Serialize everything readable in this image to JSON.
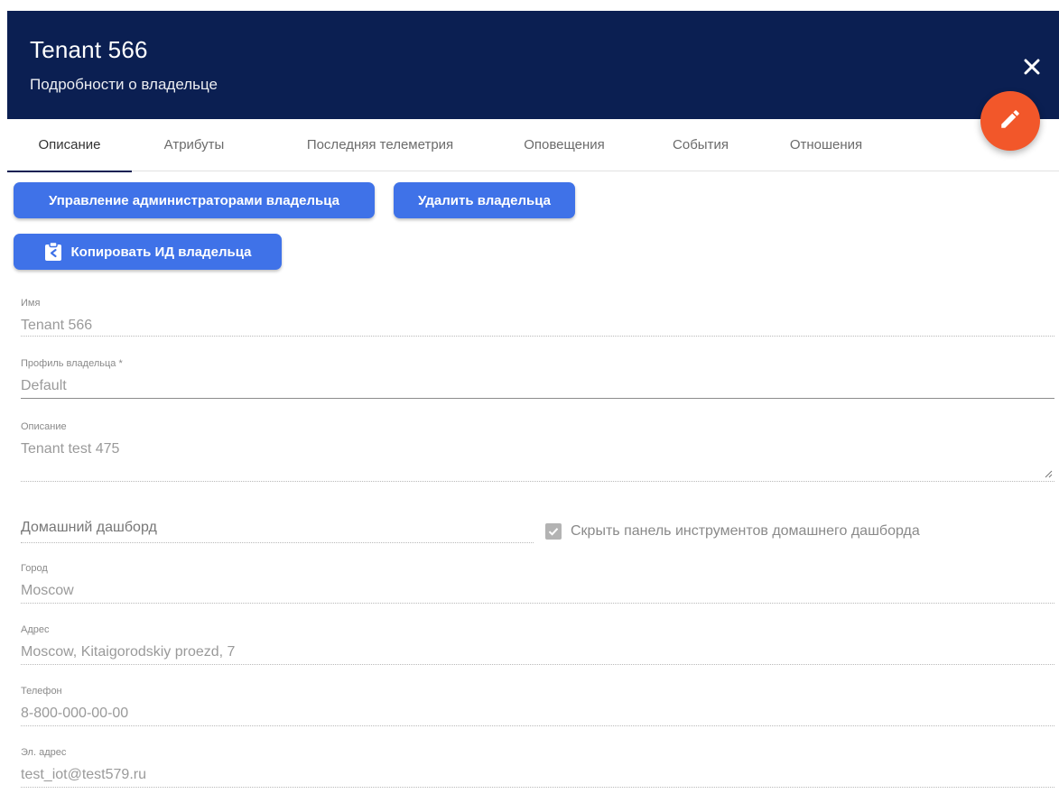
{
  "header": {
    "title": "Tenant 566",
    "subtitle": "Подробности о владельце",
    "close_icon": "close-icon",
    "edit_icon": "pencil-icon"
  },
  "tabs": [
    {
      "label": "Описание",
      "active": true
    },
    {
      "label": "Атрибуты"
    },
    {
      "label": "Последняя телеметрия"
    },
    {
      "label": "Оповещения"
    },
    {
      "label": "События"
    },
    {
      "label": "Отношения"
    }
  ],
  "actions": {
    "manage_admins": "Управление администраторами владельца",
    "delete": "Удалить владельца",
    "copy_id": "Копировать ИД владельца",
    "copy_icon": "clipboard-arrow-icon"
  },
  "form": {
    "name": {
      "label": "Имя",
      "value": "Tenant 566"
    },
    "profile": {
      "label": "Профиль владельца *",
      "value": "Default"
    },
    "description": {
      "label": "Описание",
      "value": "Tenant test 475"
    },
    "home_dashboard": {
      "placeholder": "Домашний дашборд"
    },
    "hide_toolbar": {
      "label": "Скрыть панель инструментов домашнего дашборда",
      "checked": true
    },
    "city": {
      "label": "Город",
      "value": "Moscow"
    },
    "address": {
      "label": "Адрес",
      "value": "Moscow, Kitaigorodskiy proezd, 7"
    },
    "phone": {
      "label": "Телефон",
      "value": "8-800-000-00-00"
    },
    "email": {
      "label": "Эл. адрес",
      "value": "test_iot@test579.ru"
    }
  },
  "colors": {
    "header_bg": "#0b1f52",
    "primary_button": "#3f72e8",
    "fab": "#f2572a"
  }
}
